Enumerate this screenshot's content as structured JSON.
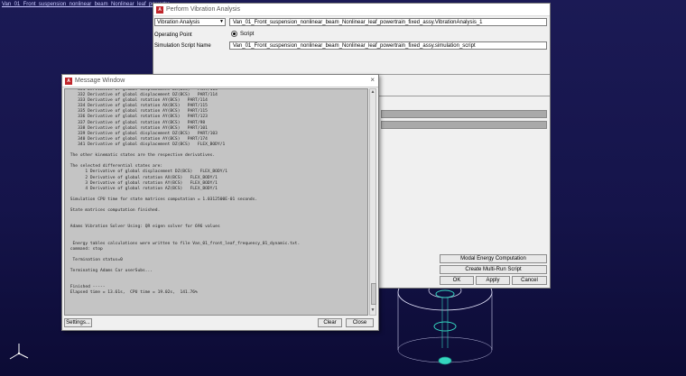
{
  "background": {
    "title": "Van_01_Front_suspension_nonlinear_beam_Nonlinear_leaf_powertra..."
  },
  "vibration_window": {
    "title": "Perform Vibration Analysis",
    "dropdown": "Vibration Analysis",
    "analysis_name": "Van_01_Front_suspension_nonlinear_beam_Nonlinear_leaf_powertrain_fixed_assy.VibrationAnalysis_1",
    "operating_point_label": "Operating Point",
    "operating_point_option": "Script",
    "sim_script_label": "Simulation Script Name",
    "sim_script_value": "Van_01_Front_suspension_nonlinear_beam_Nonlinear_leaf_powertrain_fixed_assy.simulation_script",
    "buttons": {
      "modal_energy": "Modal Energy Computation",
      "multirun": "Create Multi-Run Script",
      "ok": "OK",
      "apply": "Apply",
      "cancel": "Cancel"
    }
  },
  "message_window": {
    "title": "Message Window",
    "lines": [
      "    331 Derivative of global displacement DX(BCS)   PART/114",
      "    332 Derivative of global displacement DZ(BCS)   PART/114",
      "    333 Derivative of global rotation AY(BCS)   PART/114",
      "    334 Derivative of global rotation AX(BCS)   PART/115",
      "    335 Derivative of global rotation AY(BCS)   PART/115",
      "    336 Derivative of global rotation AY(BCS)   PART/123",
      "    337 Derivative of global rotation AY(BCS)   PART/98",
      "    338 Derivative of global rotation AY(BCS)   PART/101",
      "    339 Derivative of global displacement DZ(BCS)   PART/103",
      "    340 Derivative of global rotation AY(BCS)   PART/174",
      "    341 Derivative of global displacement DZ(BCS)   FLEX_BODY/1",
      "",
      " The other kinematic states are the respective derivatives.",
      "",
      " The selected differential states are:",
      "       1 Derivative of global displacement DZ(BCS)   FLEX_BODY/1",
      "       2 Derivative of global rotation AX(BCS)   FLEX_BODY/1",
      "       3 Derivative of global rotation AY(BCS)   FLEX_BODY/1",
      "       4 Derivative of global rotation AZ(BCS)   FLEX_BODY/1",
      "",
      " Simulation CPU time for state matrices computation = 1.0312500E-01 seconds.",
      "",
      " State matrices computation finished.",
      "",
      "",
      " Adams Vibration Solver Using: QR eigen solver for 696 values",
      "",
      "",
      "  Energy tables calculations were written to file Van_01_front_leaf_frequency_01_dynamic.txt.",
      " command: stop",
      "",
      "  Termination status=0",
      "",
      " Terminating Adams Car userSubs...",
      "",
      "",
      " Finished -----",
      " Elapsed time = 13.61s,  CPU time = 19.02s,  141.76%"
    ],
    "buttons": {
      "settings": "Settings...",
      "clear": "Clear",
      "close": "Close"
    }
  },
  "colors": {
    "viewport_bg": "#1b1a55",
    "model_wire": "#ffffff",
    "model_accent": "#35d6c0"
  }
}
